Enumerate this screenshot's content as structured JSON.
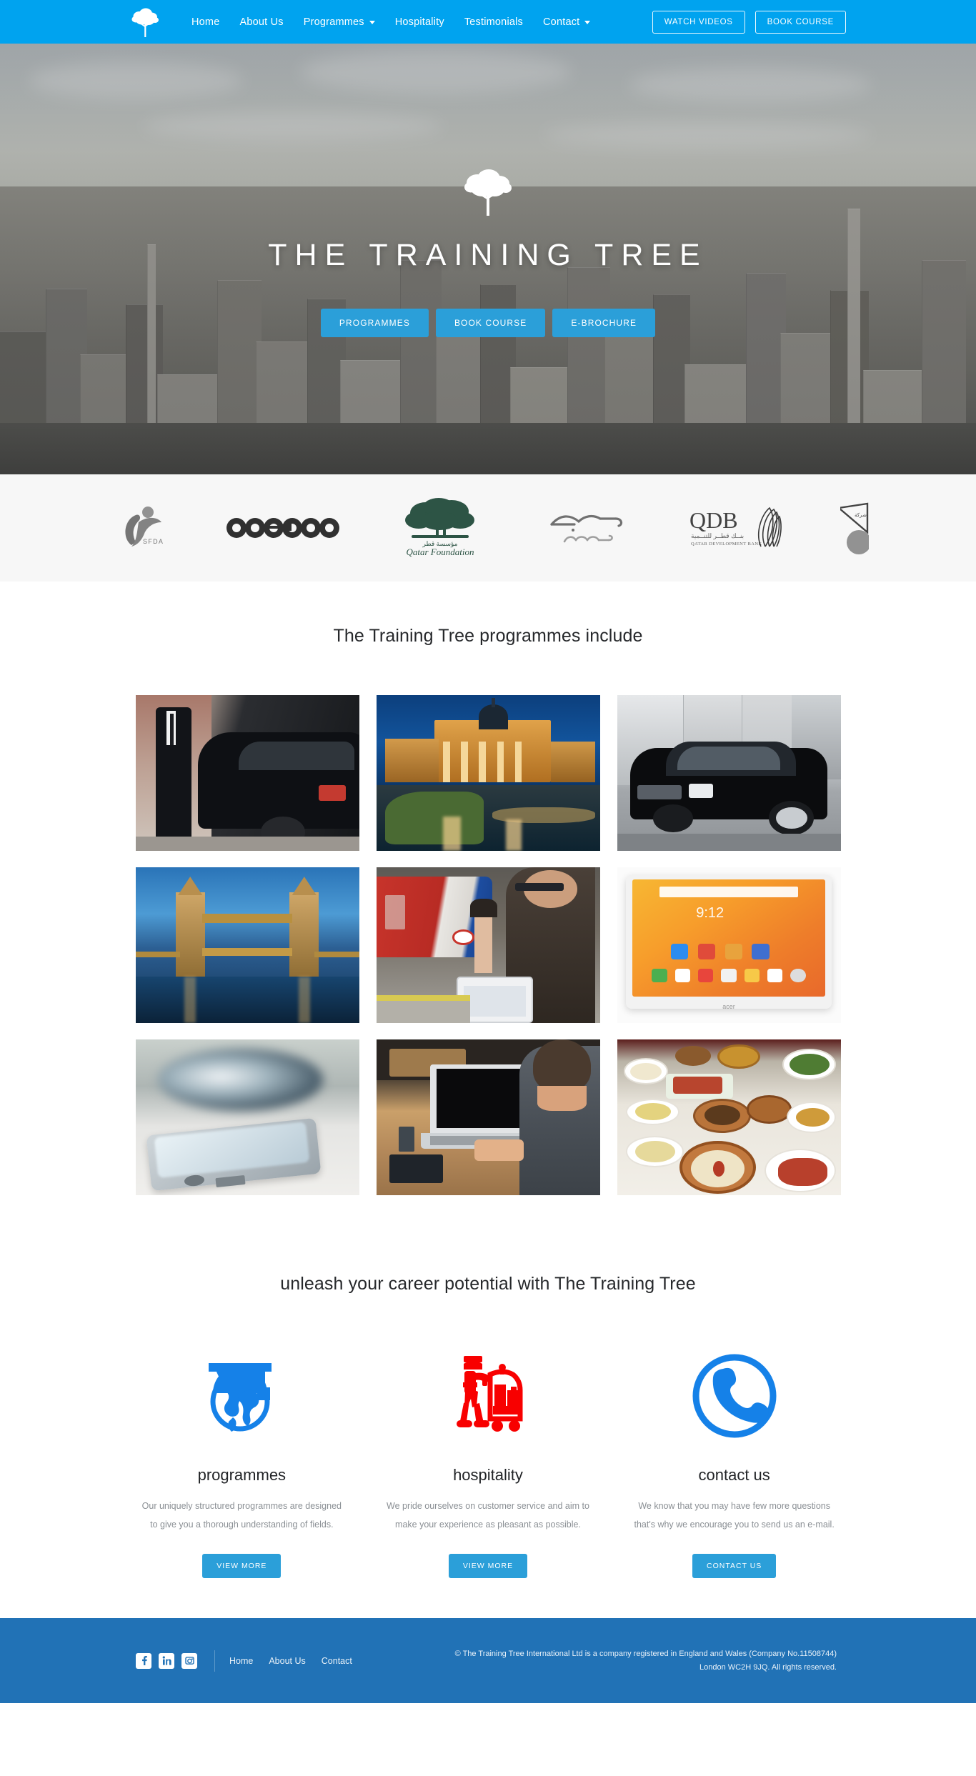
{
  "navbar": {
    "logo_icon": "tree-logo-icon",
    "links": [
      {
        "label": "Home",
        "has_caret": false
      },
      {
        "label": "About Us",
        "has_caret": false
      },
      {
        "label": "Programmes",
        "has_caret": true
      },
      {
        "label": "Hospitality",
        "has_caret": false
      },
      {
        "label": "Testimonials",
        "has_caret": false
      },
      {
        "label": "Contact",
        "has_caret": true
      }
    ],
    "watch_videos_label": "WATCH VIDEOS",
    "book_course_label": "BOOK COURSE",
    "background_color": "#00a3ef"
  },
  "hero": {
    "logo_icon": "tree-logo-icon",
    "title": "THE TRAINING TREE",
    "buttons": [
      {
        "label": "PROGRAMMES"
      },
      {
        "label": "BOOK COURSE"
      },
      {
        "label": "E-BROCHURE"
      }
    ],
    "button_color": "#2b9fd9",
    "background_description": "aerial photograph of a city skyline"
  },
  "clients": {
    "background_color": "#f7f7f7",
    "logos": [
      {
        "name": "SFDA",
        "icon": "sfda-logo-icon"
      },
      {
        "name": "ooredoo",
        "icon": "ooredoo-logo-icon"
      },
      {
        "name": "Qatar Foundation",
        "icon": "qatar-foundation-logo-icon"
      },
      {
        "name": "sabic",
        "icon": "sabic-logo-icon"
      },
      {
        "name": "QDB",
        "subtitle": "QATAR DEVELOPMENT BANK",
        "icon": "qdb-logo-icon"
      },
      {
        "name": "partner-logo",
        "icon": "partner-logo-icon"
      }
    ]
  },
  "programmes": {
    "heading": "The Training Tree programmes include",
    "tiles": [
      {
        "alt": "chauffeur standing beside a black luxury car"
      },
      {
        "alt": "Trafalgar Square and National Gallery at night"
      },
      {
        "alt": "black Mercedes-Benz S-Class in a showroom"
      },
      {
        "alt": "Tower Bridge in London at dusk"
      },
      {
        "alt": "man using a tablet on a London Underground platform"
      },
      {
        "alt": "Acer Android tablet showing home screen at 9:12"
      },
      {
        "alt": "smartphone resting on a white table"
      },
      {
        "alt": "man typing on a laptop at a wooden desk"
      },
      {
        "alt": "table spread with Middle Eastern mezze dishes"
      }
    ]
  },
  "features": {
    "heading": "unleash your career potential with The Training Tree",
    "cards": [
      {
        "icon": "graduation-globe-icon",
        "icon_color": "#1581e8",
        "title": "programmes",
        "description": "Our uniquely structured programmes are designed to give you a thorough understanding of fields.",
        "button_label": "VIEW MORE"
      },
      {
        "icon": "bellhop-luggage-cart-icon",
        "icon_color": "#f80000",
        "title": "hospitality",
        "description": "We pride ourselves on customer service and aim to make your experience as pleasant as possible.",
        "button_label": "VIEW MORE"
      },
      {
        "icon": "phone-circle-icon",
        "icon_color": "#1581e8",
        "title": "contact us",
        "description": "We know that you may have few more questions that's why we encourage you to send us an e-mail.",
        "button_label": "CONTACT US"
      }
    ]
  },
  "footer": {
    "background_color": "#2172b6",
    "social": [
      {
        "name": "facebook-icon"
      },
      {
        "name": "linkedin-icon"
      },
      {
        "name": "instagram-icon"
      }
    ],
    "links": [
      {
        "label": "Home"
      },
      {
        "label": "About Us"
      },
      {
        "label": "Contact"
      }
    ],
    "copyright_line1": "© The Training Tree International Ltd is a company registered in England and Wales (Company No.11508744)",
    "copyright_line2": "London WC2H 9JQ. All rights reserved."
  }
}
